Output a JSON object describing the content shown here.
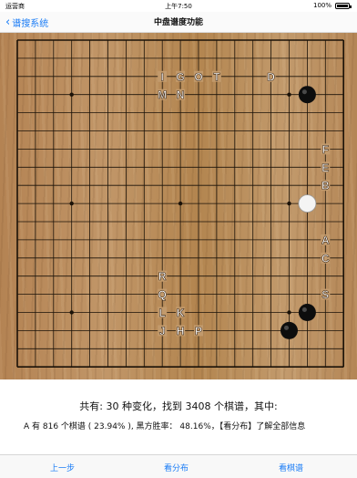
{
  "status_bar": {
    "carrier": "运营商",
    "time": "上午7:50",
    "battery": "100%"
  },
  "nav": {
    "back_label": "谱搜系统",
    "title": "中盘谱度功能"
  },
  "board": {
    "size": 19,
    "hoshi": [
      [
        3,
        3
      ],
      [
        3,
        9
      ],
      [
        3,
        15
      ],
      [
        9,
        3
      ],
      [
        9,
        9
      ],
      [
        9,
        15
      ],
      [
        15,
        3
      ],
      [
        15,
        9
      ],
      [
        15,
        15
      ]
    ],
    "stones": [
      {
        "color": "black",
        "col": 16,
        "row": 3
      },
      {
        "color": "white",
        "col": 16,
        "row": 9
      },
      {
        "color": "black",
        "col": 16,
        "row": 15
      },
      {
        "color": "black",
        "col": 15,
        "row": 16
      }
    ],
    "labels": [
      {
        "text": "I",
        "col": 8,
        "row": 2
      },
      {
        "text": "G",
        "col": 9,
        "row": 2
      },
      {
        "text": "O",
        "col": 10,
        "row": 2
      },
      {
        "text": "T",
        "col": 11,
        "row": 2
      },
      {
        "text": "D",
        "col": 14,
        "row": 2
      },
      {
        "text": "M",
        "col": 8,
        "row": 3
      },
      {
        "text": "N",
        "col": 9,
        "row": 3
      },
      {
        "text": "F",
        "col": 17,
        "row": 6
      },
      {
        "text": "E",
        "col": 17,
        "row": 7
      },
      {
        "text": "B",
        "col": 17,
        "row": 8
      },
      {
        "text": "A",
        "col": 17,
        "row": 11
      },
      {
        "text": "C",
        "col": 17,
        "row": 12
      },
      {
        "text": "R",
        "col": 8,
        "row": 13
      },
      {
        "text": "S",
        "col": 17,
        "row": 14
      },
      {
        "text": "Q",
        "col": 8,
        "row": 14
      },
      {
        "text": "L",
        "col": 8,
        "row": 15
      },
      {
        "text": "K",
        "col": 9,
        "row": 15
      },
      {
        "text": "J",
        "col": 8,
        "row": 16
      },
      {
        "text": "H",
        "col": 9,
        "row": 16
      },
      {
        "text": "P",
        "col": 10,
        "row": 16
      }
    ]
  },
  "summary": {
    "line1": "共有: 30 种变化，找到 3408 个棋谱，其中:",
    "line2": "A 有 816 个棋谱 ( 23.94% ), 黑方胜率： 48.16%，【看分布】了解全部信息"
  },
  "toolbar": {
    "prev_label": "上一步",
    "dist_label": "看分布",
    "games_label": "看棋谱"
  },
  "colors": {
    "accent": "#1a7cf6",
    "grid": "#1b1208"
  }
}
